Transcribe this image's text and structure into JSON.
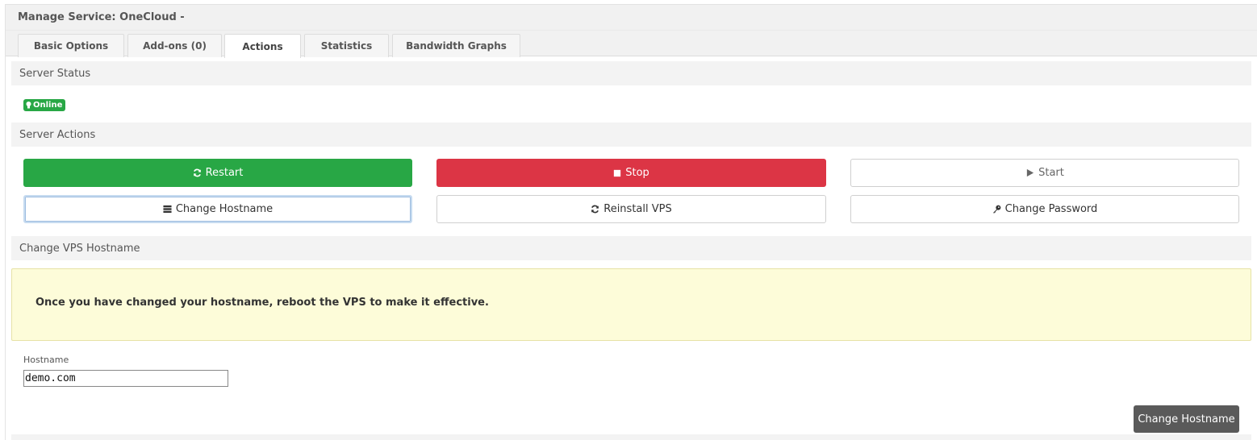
{
  "panel": {
    "title": "Manage Service: OneCloud -"
  },
  "tabs": [
    {
      "label": "Basic Options",
      "active": false
    },
    {
      "label": "Add-ons (0)",
      "active": false
    },
    {
      "label": "Actions",
      "active": true
    },
    {
      "label": "Statistics",
      "active": false
    },
    {
      "label": "Bandwidth Graphs",
      "active": false
    }
  ],
  "server_status": {
    "heading": "Server Status",
    "badge": "Online",
    "badge_icon": "lightbulb-icon",
    "badge_color": "#28a745"
  },
  "server_actions": {
    "heading": "Server Actions",
    "restart": {
      "label": "Restart",
      "icon": "refresh-icon",
      "color": "#28a745"
    },
    "stop": {
      "label": "Stop",
      "icon": "stop-icon",
      "color": "#dc3545"
    },
    "start": {
      "label": "Start",
      "icon": "play-icon"
    },
    "change_hostname": {
      "label": "Change Hostname",
      "icon": "server-icon"
    },
    "reinstall": {
      "label": "Reinstall VPS",
      "icon": "refresh-icon"
    },
    "change_password": {
      "label": "Change Password",
      "icon": "key-icon"
    }
  },
  "hostname_section": {
    "heading": "Change VPS Hostname",
    "notice": "Once you have changed your hostname, reboot the VPS to make it effective.",
    "field_label": "Hostname",
    "field_value": "demo.com",
    "submit_label": "Change Hostname"
  }
}
